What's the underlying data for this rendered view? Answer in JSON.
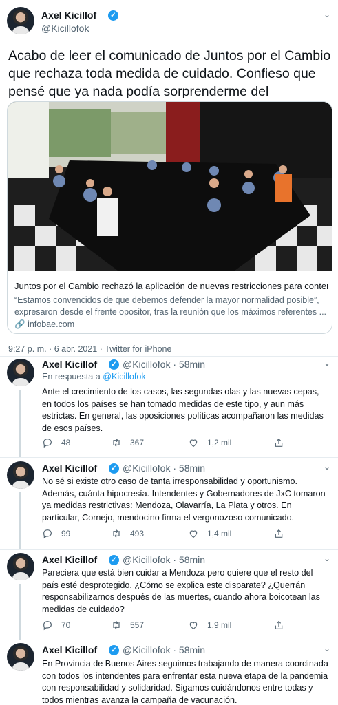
{
  "main_tweet": {
    "author_name": "Axel Kicillof",
    "author_handle": "@Kicillofok",
    "text": "Acabo de leer el comunicado de Juntos por el Cambio que rechaza toda medida de cuidado. Confieso que pensé que ya nada podía sorprenderme del macrismo.",
    "card": {
      "title": "Juntos por el Cambio rechazó la aplicación de nuevas restricciones para conten...",
      "description": "“Estamos convencidos de que debemos defender la mayor normalidad posible”, expresaron desde el frente opositor, tras la reunión que los máximos referentes ...",
      "domain": "infobae.com"
    },
    "timestamp": "9:27 p. m. · 6 abr. 2021",
    "source": "Twitter for iPhone"
  },
  "replies": [
    {
      "author_name": "Axel Kicillof",
      "author_handle": "@Kicillofok",
      "time": "58min",
      "in_reply_label": "En respuesta a",
      "in_reply_handle": "@Kicillofok",
      "text": "Ante el crecimiento de los casos, las segundas olas y las nuevas cepas, en todos los países se han tomado medidas de este tipo, y aun más estrictas. En general, las oposiciones políticas acompañaron las medidas de esos países.",
      "replies": "48",
      "retweets": "367",
      "likes": "1,2 mil"
    },
    {
      "author_name": "Axel Kicillof",
      "author_handle": "@Kicillofok",
      "time": "58min",
      "text": "No sé si existe otro caso de tanta irresponsabilidad y oportunismo. Además, cuánta hipocresía. Intendentes y Gobernadores de JxC tomaron ya medidas restrictivas: Mendoza, Olavarría, La Plata y otros. En particular, Cornejo, mendocino firma el vergonozoso comunicado.",
      "replies": "99",
      "retweets": "493",
      "likes": "1,4 mil"
    },
    {
      "author_name": "Axel Kicillof",
      "author_handle": "@Kicillofok",
      "time": "58min",
      "text": "Pareciera que está bien cuidar a Mendoza pero quiere que el resto del país esté desprotegido. ¿Cómo se explica este disparate? ¿Querrán responsabilizarnos después de las muertes, cuando ahora boicotean las medidas de cuidado?",
      "replies": "70",
      "retweets": "557",
      "likes": "1,9 mil"
    },
    {
      "author_name": "Axel Kicillof",
      "author_handle": "@Kicillofok",
      "time": "58min",
      "text": "En Provincia de Buenos Aires seguimos trabajando de manera coordinada con todos los intendentes para enfrentar esta nueva etapa de la pandemia con responsabilidad y solidaridad. Sigamos cuidándonos entre todas y todos mientras avanza la campaña de vacunación."
    }
  ],
  "icons": {
    "verified": "verified-badge-icon",
    "caret": "chevron-down-icon",
    "reply": "reply-icon",
    "retweet": "retweet-icon",
    "like": "heart-icon",
    "share": "share-icon",
    "link": "link-icon"
  },
  "colors": {
    "accent": "#1d9bf0",
    "text": "#0f1419",
    "secondary": "#536471"
  }
}
